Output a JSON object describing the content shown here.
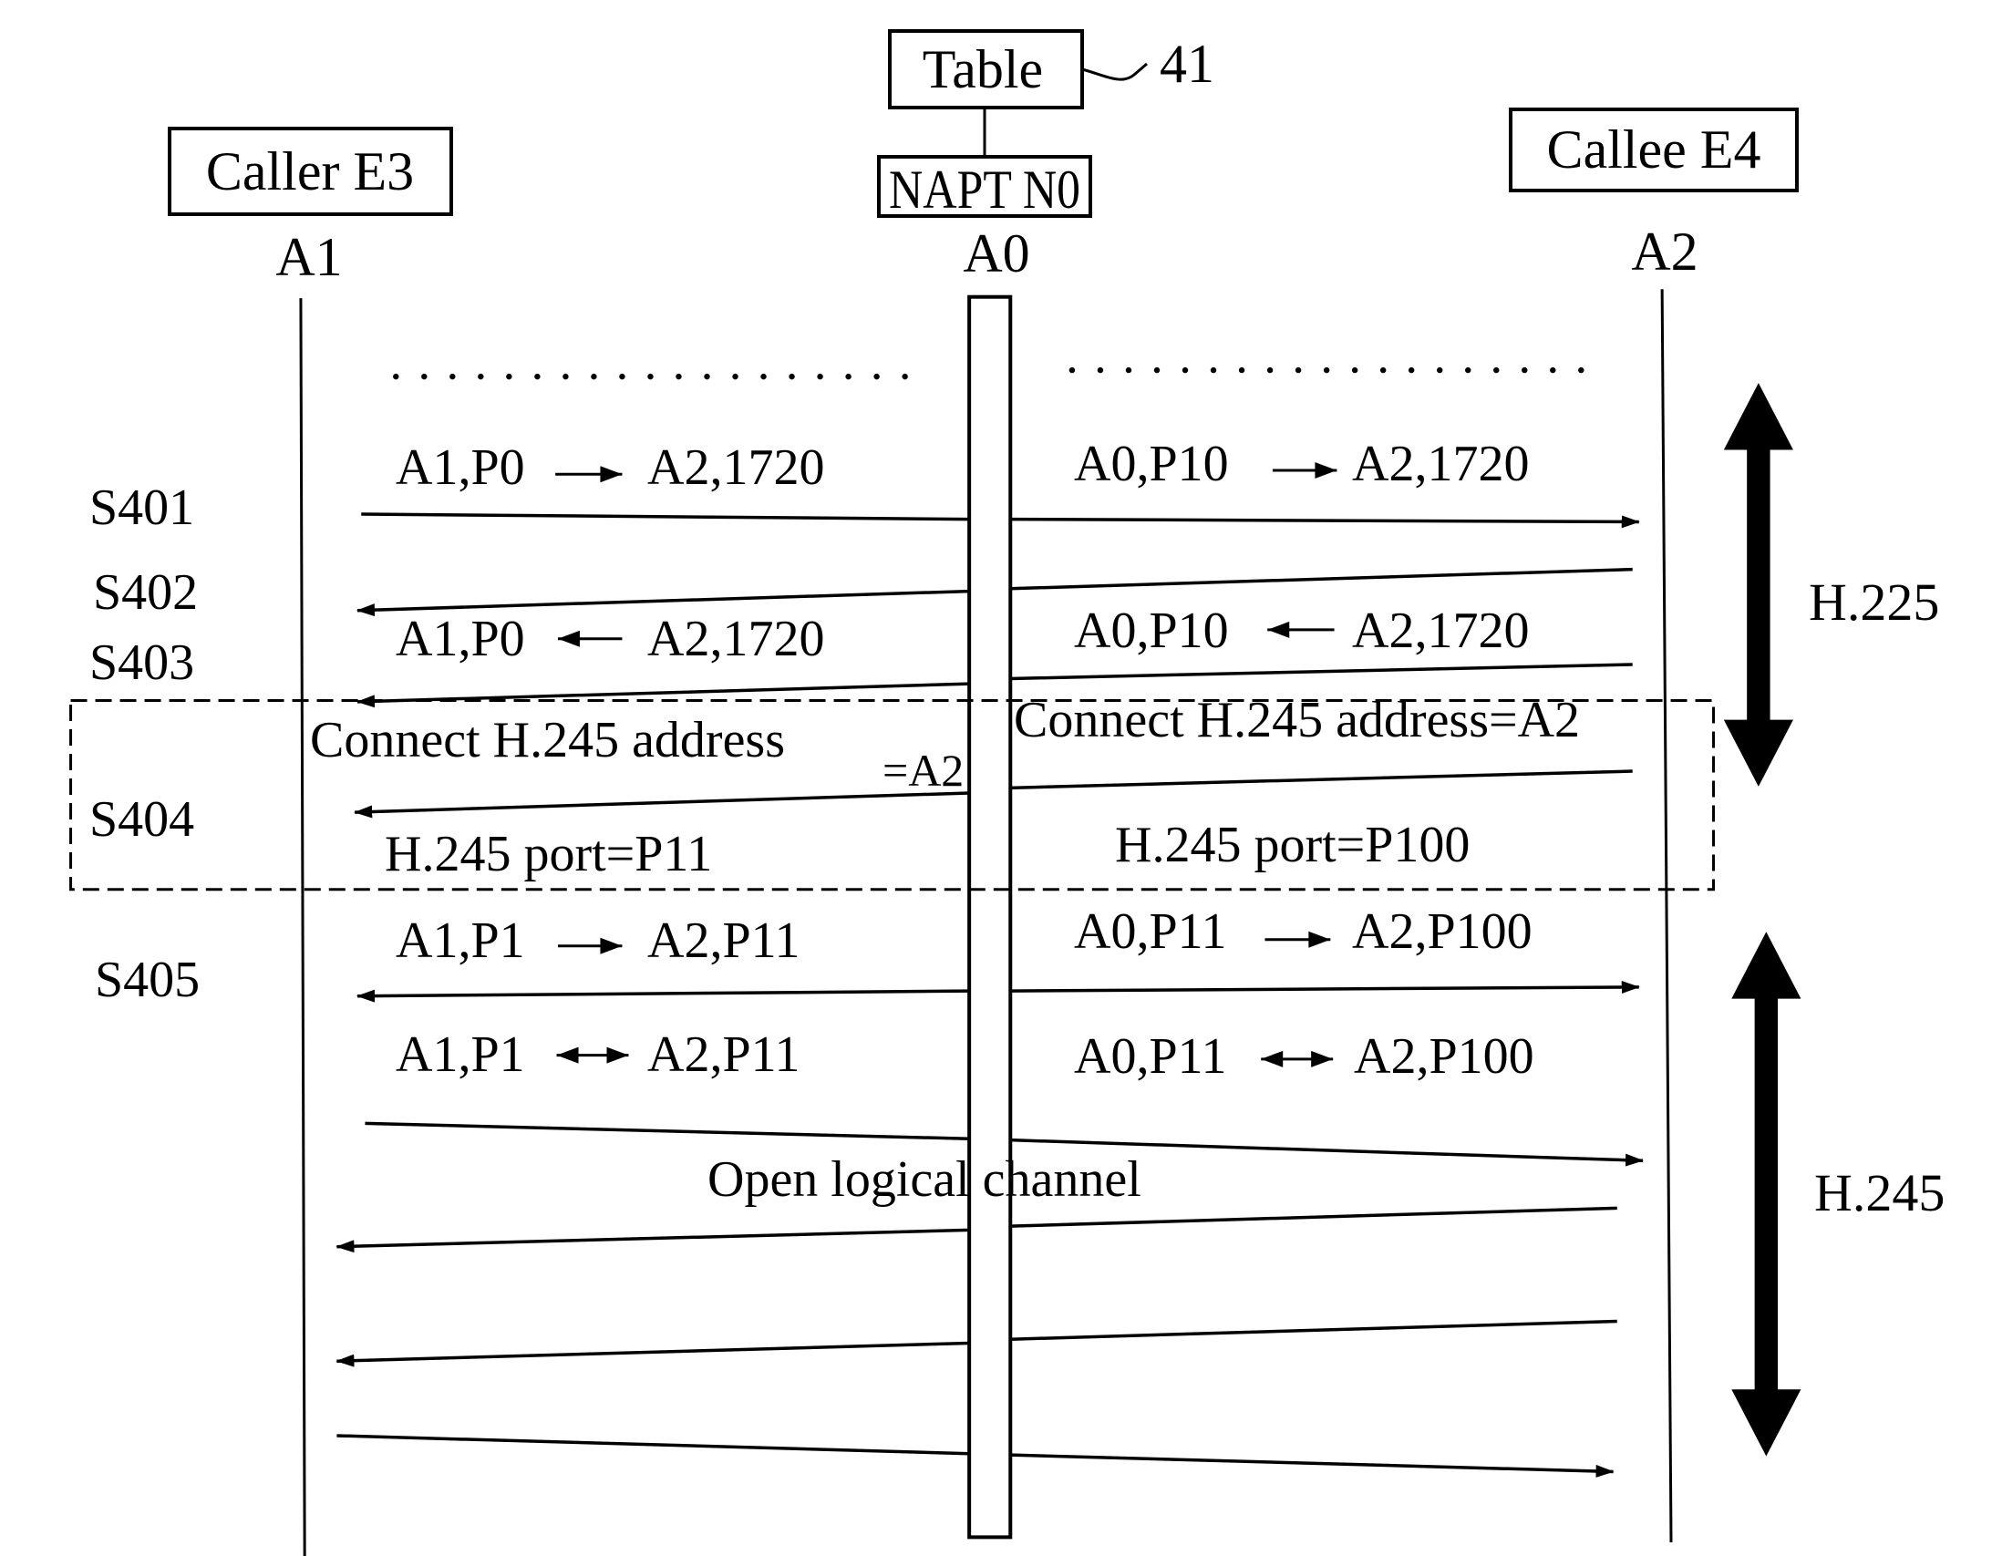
{
  "figure": {
    "reference_numeral": "41",
    "colors": {
      "ink": "#000000",
      "paper": "#ffffff"
    }
  },
  "entities": {
    "caller": {
      "box_label": "Caller E3",
      "address": "A1"
    },
    "table": {
      "box_label": "Table"
    },
    "napt": {
      "box_label": "NAPT N0",
      "address": "A0"
    },
    "callee": {
      "box_label": "Callee E4",
      "address": "A2"
    }
  },
  "steps": {
    "s401": "S401",
    "s402": "S402",
    "s403": "S403",
    "s404": "S404",
    "s405": "S405"
  },
  "messages": {
    "m1_left": {
      "from": "A1,P0",
      "arrow": "right",
      "to": "A2,1720"
    },
    "m1_right": {
      "from": "A0,P10",
      "arrow": "right",
      "to": "A2,1720"
    },
    "m2_left": {
      "from": "A1,P0",
      "arrow": "left",
      "to": "A2,1720"
    },
    "m2_right": {
      "from": "A0,P10",
      "arrow": "left",
      "to": "A2,1720"
    },
    "connect_left": {
      "text": "Connect H.245 address",
      "suffix": "=A2"
    },
    "connect_right": {
      "text": "Connect H.245 address=A2"
    },
    "port_left": "H.245 port=P11",
    "port_right": "H.245 port=P100",
    "m5_left": {
      "from": "A1,P1",
      "arrow": "right",
      "to": "A2,P11"
    },
    "m5_right": {
      "from": "A0,P11",
      "arrow": "right",
      "to": "A2,P100"
    },
    "m6_left": {
      "from": "A1,P1",
      "arrow": "both",
      "to": "A2,P11"
    },
    "m6_right": {
      "from": "A0,P11",
      "arrow": "both",
      "to": "A2,P100"
    },
    "olc": "Open logical channel"
  },
  "phases": {
    "h225": "H.225",
    "h245": "H.245"
  },
  "ellipsis": "dotted continuation"
}
